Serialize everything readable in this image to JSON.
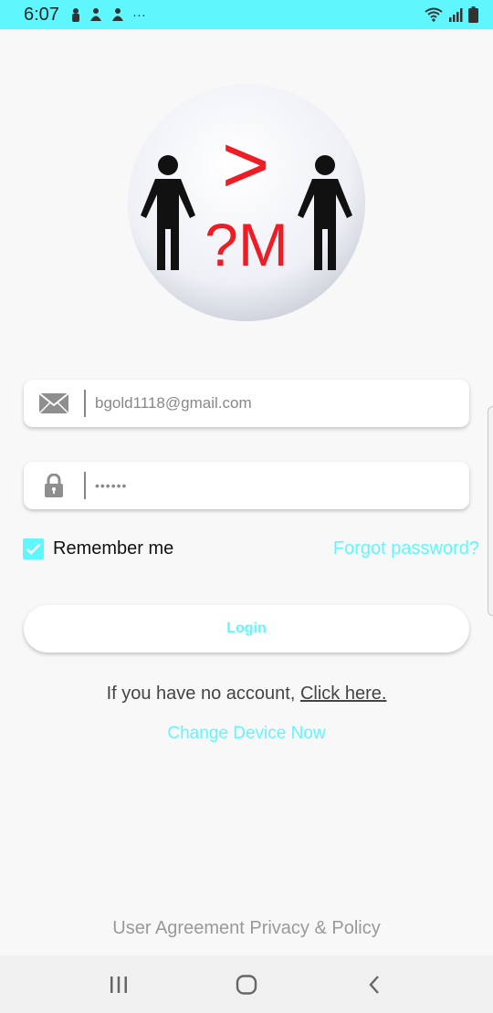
{
  "status_bar": {
    "time": "6:07",
    "more": "···",
    "bg_color": "#5ff7fd"
  },
  "logo": {
    "symbol_top": ">",
    "symbol_bottom": "?M",
    "accent_color": "#ee1c24"
  },
  "email_field": {
    "icon": "envelope-icon",
    "value": "bgold1118@gmail.com"
  },
  "password_field": {
    "icon": "lock-icon",
    "value": "••••••"
  },
  "remember": {
    "label": "Remember me",
    "checked": true
  },
  "forgot_password": "Forgot password?",
  "login_label": "Login",
  "no_account": {
    "prefix": "If you have no account, ",
    "link": "Click here."
  },
  "change_device": "Change Device Now",
  "footer": "User Agreement Privacy & Policy",
  "nav": {
    "recent": "recent-apps-icon",
    "home": "home-icon",
    "back": "back-icon"
  },
  "accent_color": "#5ff7fd"
}
